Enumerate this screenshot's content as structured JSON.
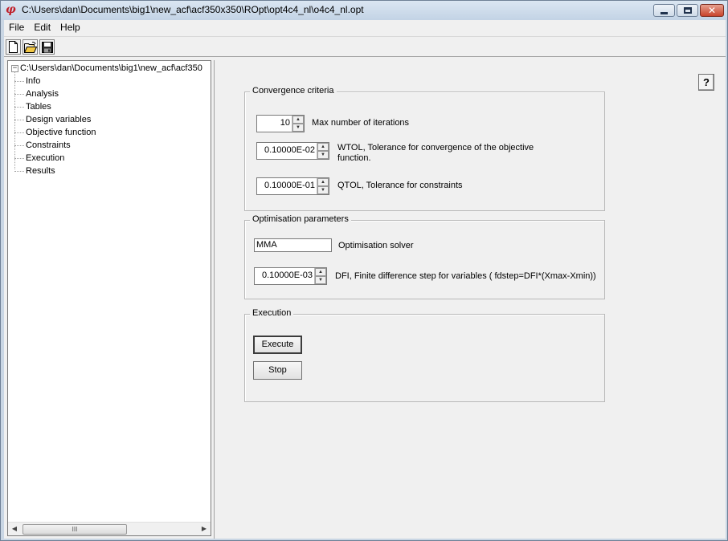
{
  "window": {
    "title": "C:\\Users\\dan\\Documents\\big1\\new_acf\\acf350x350\\ROpt\\opt4c4_nl\\o4c4_nl.opt",
    "app_icon_glyph": "φ"
  },
  "menu": {
    "items": [
      "File",
      "Edit",
      "Help"
    ]
  },
  "toolbar": {
    "new_icon": "new-document-icon",
    "open_icon": "open-folder-icon",
    "save_icon": "save-disk-icon"
  },
  "tree": {
    "root_label": "C:\\Users\\dan\\Documents\\big1\\new_acf\\acf350",
    "expander": "−",
    "items": [
      "Info",
      "Analysis",
      "Tables",
      "Design variables",
      "Objective function",
      "Constraints",
      "Execution",
      "Results"
    ],
    "scroll_left": "◀",
    "scroll_right": "▶",
    "scroll_grip": "III"
  },
  "help": {
    "label": "?"
  },
  "convergence": {
    "title": "Convergence criteria",
    "max_iter_value": "10",
    "max_iter_label": "Max number of iterations",
    "wtol_value": "0.10000E-02",
    "wtol_label_line1": "WTOL, Tolerance for convergence of the objective",
    "wtol_label_line2": "function.",
    "qtol_value": "0.10000E-01",
    "qtol_label": "QTOL, Tolerance for constraints"
  },
  "optimisation": {
    "title": "Optimisation parameters",
    "solver_value": "MMA",
    "solver_label": "Optimisation solver",
    "dfi_value": "0.10000E-03",
    "dfi_label": "DFI, Finite difference step for variables ( fdstep=DFI*(Xmax-Xmin))"
  },
  "execution": {
    "title": "Execution",
    "execute_label": "Execute",
    "stop_label": "Stop"
  },
  "spin": {
    "up": "▲",
    "down": "▼"
  },
  "caption": {
    "close_glyph": "✕"
  }
}
